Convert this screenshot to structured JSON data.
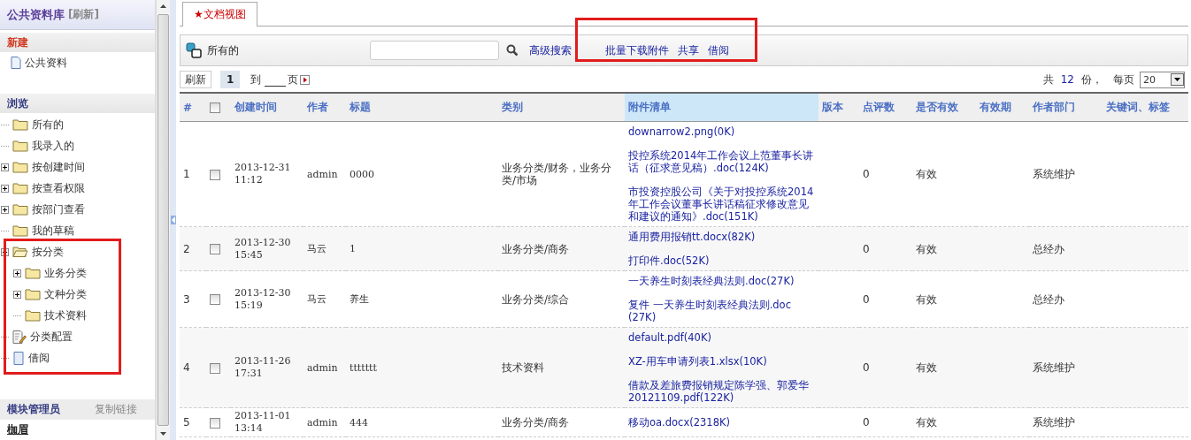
{
  "sidebar": {
    "title": "公共资料库",
    "refresh": "[刷新]",
    "new_section": {
      "label": "新建",
      "items": [
        {
          "label": "公共资料",
          "kind": "page"
        }
      ]
    },
    "browse_section": {
      "label": "浏览",
      "tree": [
        {
          "label": "所有的",
          "kind": "folder"
        },
        {
          "label": "我录入的",
          "kind": "folder"
        },
        {
          "label": "按创建时间",
          "kind": "folder",
          "expanded": false
        },
        {
          "label": "按查看权限",
          "kind": "folder",
          "expanded": false
        },
        {
          "label": "按部门查看",
          "kind": "folder",
          "expanded": false
        },
        {
          "label": "我的草稿",
          "kind": "folder"
        },
        {
          "label": "按分类",
          "kind": "folder",
          "expanded": true,
          "children": [
            {
              "label": "业务分类",
              "kind": "folder",
              "expanded": false
            },
            {
              "label": "文种分类",
              "kind": "folder",
              "expanded": false
            },
            {
              "label": "技术资料",
              "kind": "folder"
            }
          ]
        },
        {
          "label": "分类配置",
          "kind": "config"
        },
        {
          "label": "借阅",
          "kind": "page"
        }
      ]
    },
    "footer": {
      "label": "模块管理员",
      "link": "复制链接",
      "user": "枷眉"
    }
  },
  "tabs": [
    {
      "label": "★文档视图",
      "selected": true
    }
  ],
  "toolbar": {
    "scope": "所有的",
    "advanced": "高级搜索",
    "actions": [
      "批量下载附件",
      "共享",
      "借阅"
    ]
  },
  "pager": {
    "refresh": "刷新",
    "page": "1",
    "goto": "到",
    "page_unit": "页",
    "total_prefix": "共",
    "total": "12",
    "total_suffix": "份，",
    "per_page_label": "每页",
    "per_page": "20"
  },
  "table": {
    "columns": [
      {
        "label": "#",
        "highlighted": false
      },
      {
        "kind": "checkbox",
        "checked": false,
        "highlighted": false
      },
      {
        "label": "创建时间",
        "highlighted": false
      },
      {
        "label": "作者",
        "highlighted": false
      },
      {
        "label": "标题",
        "highlighted": false
      },
      {
        "label": "类别",
        "highlighted": false
      },
      {
        "label": "附件清单",
        "highlighted": true
      },
      {
        "label": "版本",
        "highlighted": false
      },
      {
        "label": "点评数",
        "highlighted": false
      },
      {
        "label": "是否有效",
        "highlighted": false
      },
      {
        "label": "有效期",
        "highlighted": false
      },
      {
        "label": "作者部门",
        "highlighted": false
      },
      {
        "label": "关键词、标签",
        "highlighted": false
      }
    ],
    "rows": [
      {
        "num": "1",
        "checked": false,
        "date": "2013-12-31",
        "time": "11:12",
        "author": "admin",
        "title": "0000",
        "category": "业务分类/财务，业务分类/市场",
        "attachments": [
          "downarrow2.png(0K)",
          "投控系统2014年工作会议上范董事长讲话（征求意见稿）.doc(124K)",
          "市投资控股公司《关于对投控系统2014年工作会议董事长讲话稿征求修改意见和建议的通知》.doc(151K)"
        ],
        "comments": "0",
        "valid": "有效",
        "dept": "系统维护"
      },
      {
        "num": "2",
        "checked": false,
        "date": "2013-12-30",
        "time": "15:45",
        "author": "马云",
        "title": "1",
        "category": "业务分类/商务",
        "attachments": [
          "通用费用报销tt.docx(82K)",
          "打印件.doc(52K)"
        ],
        "comments": "0",
        "valid": "有效",
        "dept": "总经办"
      },
      {
        "num": "3",
        "checked": false,
        "date": "2013-12-30",
        "time": "15:19",
        "author": "马云",
        "title": "养生",
        "category": "业务分类/综合",
        "attachments": [
          "一天养生时刻表经典法则.doc(27K)",
          "复件 一天养生时刻表经典法则.doc (27K)"
        ],
        "comments": "0",
        "valid": "有效",
        "dept": "总经办"
      },
      {
        "num": "4",
        "checked": false,
        "date": "2013-11-26",
        "time": "17:31",
        "author": "admin",
        "title": "ttttttt",
        "category": "技术资料",
        "attachments": [
          "default.pdf(40K)",
          "XZ-用车申请列表1.xlsx(10K)",
          "借款及差旅费报销规定陈学强、郭爱华20121109.pdf(122K)"
        ],
        "comments": "0",
        "valid": "有效",
        "dept": "系统维护"
      },
      {
        "num": "5",
        "checked": false,
        "date": "2013-11-01",
        "time": "13:14",
        "author": "admin",
        "title": "444",
        "category": "业务分类/商务",
        "attachments": [
          "移动oa.docx(2318K)"
        ],
        "comments": "0",
        "valid": "有效",
        "dept": "系统维护"
      }
    ]
  }
}
